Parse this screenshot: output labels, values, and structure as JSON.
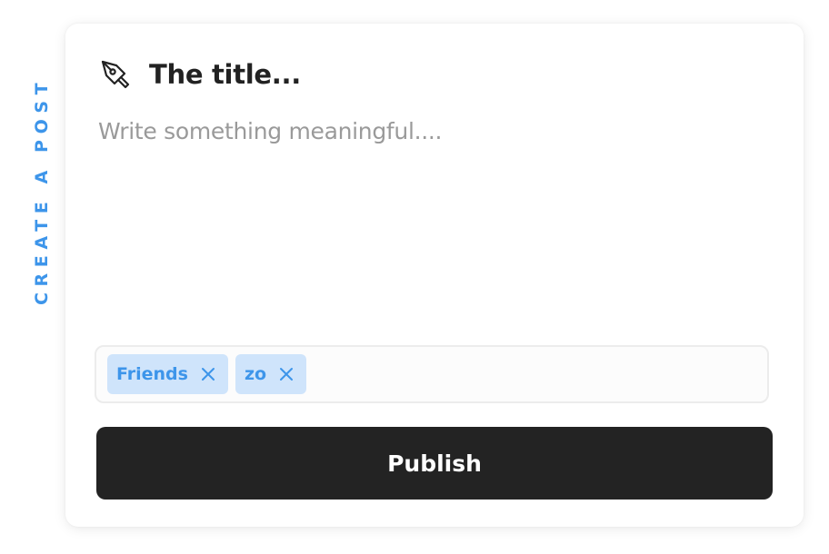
{
  "sidebar": {
    "label": "CREATE A POST"
  },
  "post": {
    "title_placeholder": "The title...",
    "body_placeholder": "Write something meaningful....",
    "title_icon": "pen-nib-icon"
  },
  "tags": [
    {
      "label": "Friends",
      "remove_icon": "close-icon"
    },
    {
      "label": "zo",
      "remove_icon": "close-icon"
    }
  ],
  "actions": {
    "publish_label": "Publish"
  },
  "colors": {
    "accent": "#3d95ea",
    "tag_bg": "#cfe4fb",
    "button_bg": "#232323",
    "placeholder": "#9a9a9a"
  }
}
